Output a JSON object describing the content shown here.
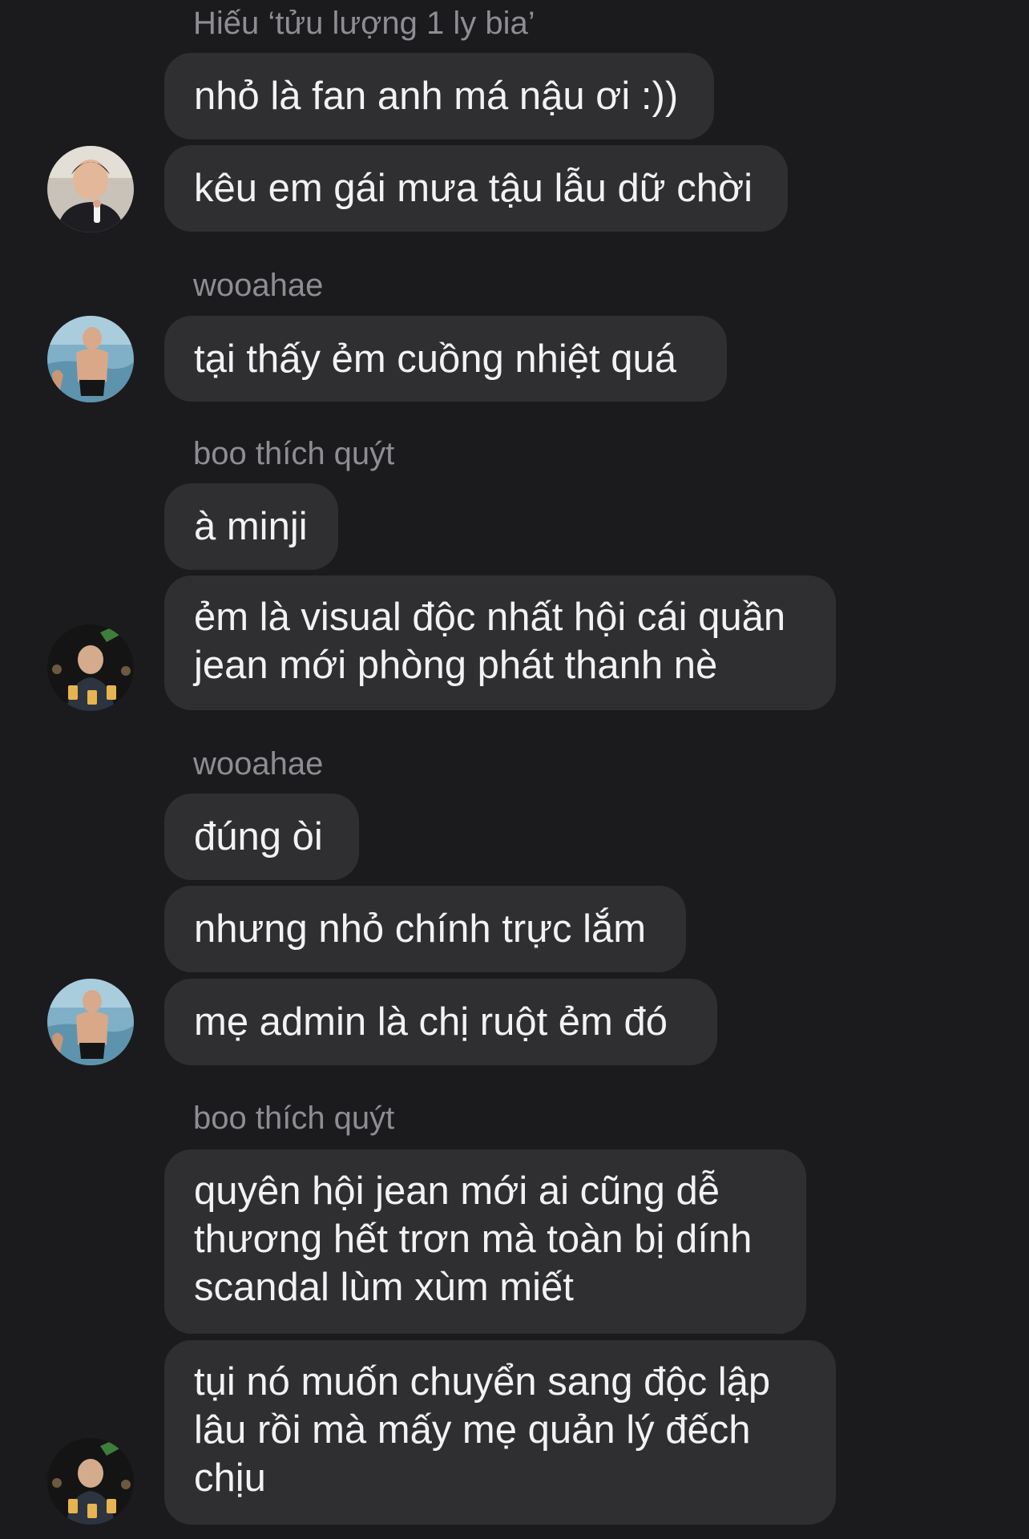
{
  "groups": [
    {
      "sender": "Hiếu ‘tửu lượng 1 ly bia’",
      "messages": [
        "nhỏ là fan anh má nậu ơi :))",
        "kêu em gái mưa tậu lẫu dữ chời"
      ],
      "avatar": "user-photo-a"
    },
    {
      "sender": "wooahae",
      "messages": [
        "tại thấy ẻm cuồng nhiệt quá"
      ],
      "avatar": "user-photo-b"
    },
    {
      "sender": "boo thích quýt",
      "messages": [
        "à minji",
        "ẻm là visual độc nhất hội cái quần jean mới phòng phát thanh nè"
      ],
      "avatar": "user-photo-c"
    },
    {
      "sender": "wooahae",
      "messages": [
        "đúng òi",
        "nhưng nhỏ chính trực lắm",
        "mẹ admin là chị ruột ẻm đó"
      ],
      "avatar": "user-photo-b"
    },
    {
      "sender": "boo thích quýt",
      "messages": [
        "quyên hội jean mới ai cũng dễ thương hết trơn mà toàn bị dính scandal lùm xùm miết",
        "tụi nó muốn chuyển sang độc lập lâu rồi mà mấy mẹ quản lý đếch chịu"
      ],
      "avatar": "user-photo-c"
    }
  ],
  "colors": {
    "background": "#1b1b1d",
    "bubble": "#2f2f32",
    "message_text": "#f2f2f3",
    "sender_text": "#8d8d93"
  }
}
